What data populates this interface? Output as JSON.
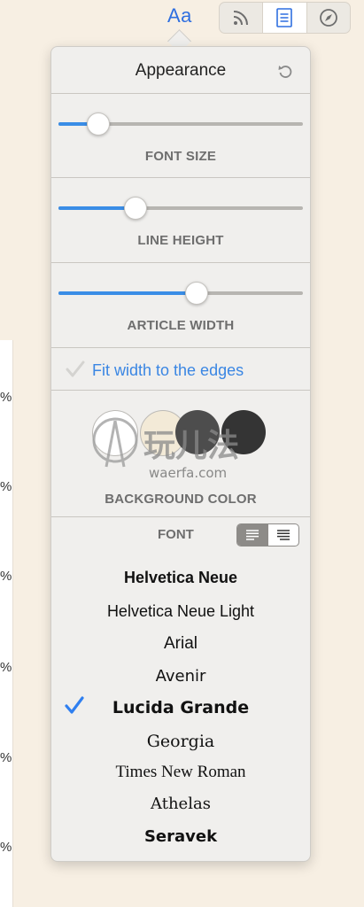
{
  "toolbar": {
    "appearance_label": "Aa",
    "icons": [
      "rss-icon",
      "reader-icon",
      "compass-icon"
    ],
    "active": "reader-icon"
  },
  "background_page": {
    "percent_labels": [
      "%",
      "%",
      "%",
      "%",
      "%",
      "%"
    ]
  },
  "popover": {
    "title": "Appearance",
    "reset_icon": "reset-icon",
    "sliders": [
      {
        "label": "FONT SIZE",
        "value": 0.16
      },
      {
        "label": "LINE HEIGHT",
        "value": 0.31
      },
      {
        "label": "ARTICLE WIDTH",
        "value": 0.56
      }
    ],
    "fit_width": {
      "label": "Fit width to the edges",
      "checked": false
    },
    "background_color": {
      "label": "BACKGROUND COLOR",
      "swatches": [
        "#ffffff",
        "#f3ead7",
        "#4d4d4d",
        "#1f1f1f"
      ],
      "watermark_cn": "玩儿法",
      "watermark_url": "waerfa.com"
    },
    "font": {
      "label": "FONT",
      "align_options": [
        "align-left-icon",
        "justify-icon"
      ],
      "selected_align": "align-left-icon",
      "items": [
        "Helvetica Neue",
        "Helvetica Neue Light",
        "Arial",
        "Avenir",
        "Lucida Grande",
        "Georgia",
        "Times New Roman",
        "Athelas",
        "Seravek"
      ],
      "selected": "Lucida Grande"
    }
  },
  "colors": {
    "accent": "#3a8de6",
    "link": "#2f6fe0",
    "panel": "#f0efed",
    "background": "#f7efe3"
  }
}
